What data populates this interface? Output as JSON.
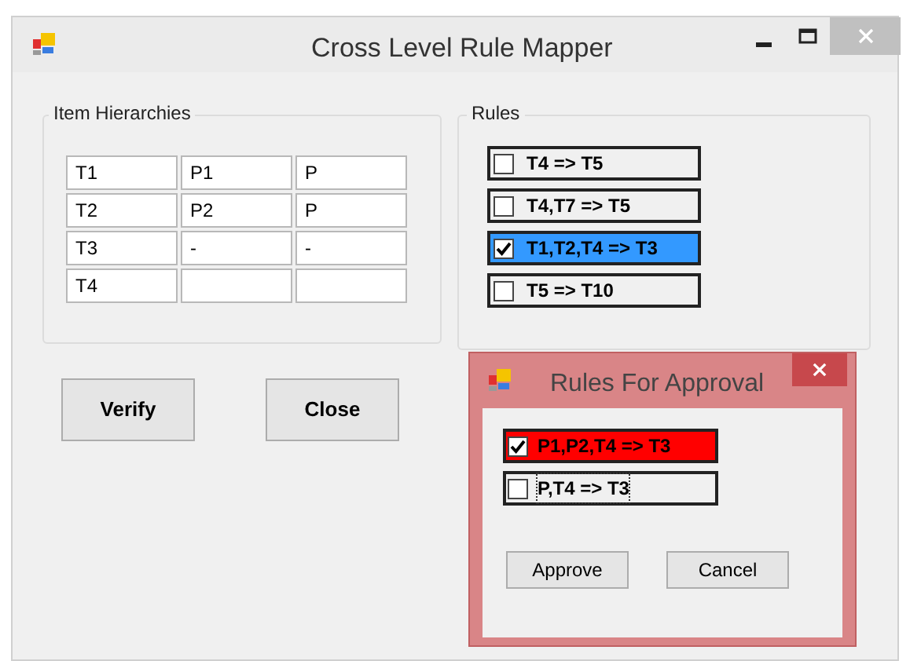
{
  "window": {
    "title": "Cross Level Rule Mapper"
  },
  "item_hierarchies": {
    "title": "Item Hierarchies",
    "rows": [
      [
        "T1",
        "P1",
        "P"
      ],
      [
        "T2",
        "P2",
        "P"
      ],
      [
        "T3",
        "-",
        "-"
      ],
      [
        "T4",
        null,
        null
      ]
    ]
  },
  "rules": {
    "title": "Rules",
    "items": [
      {
        "label": "T4 => T5",
        "checked": false,
        "selected": false
      },
      {
        "label": "T4,T7 => T5",
        "checked": false,
        "selected": false
      },
      {
        "label": "T1,T2,T4 => T3",
        "checked": true,
        "selected": true
      },
      {
        "label": "T5 => T10",
        "checked": false,
        "selected": false
      }
    ]
  },
  "buttons": [
    "Verify",
    "Close"
  ],
  "dialog": {
    "title": "Rules For Approval",
    "items": [
      {
        "label": "P1,P2,T4 => T3",
        "checked": true,
        "color": "#ff0000",
        "focused": false
      },
      {
        "label": "P,T4 => T3",
        "checked": false,
        "focused": true
      }
    ],
    "buttons": [
      "Approve",
      "Cancel"
    ]
  }
}
